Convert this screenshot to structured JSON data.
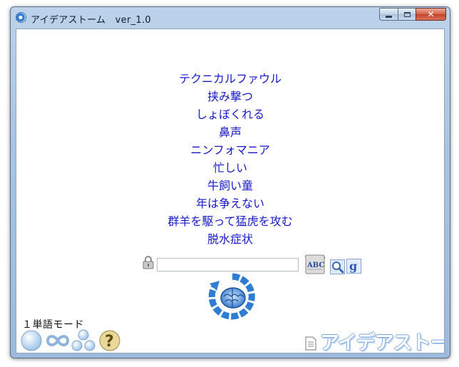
{
  "window": {
    "title": "アイデアストーム　ver_1.0",
    "minimize_label": "minimize",
    "maximize_label": "maximize",
    "close_glyph": "✕"
  },
  "words": [
    "テクニカルファウル",
    "挟み撃つ",
    "しょぼくれる",
    "鼻声",
    "ニンフォマニア",
    "忙しい",
    "牛飼い童",
    "年は争えない",
    "群羊を駆って猛虎を攻む",
    "脱水症状"
  ],
  "search": {
    "value": "",
    "placeholder": ""
  },
  "mode": {
    "label": "１単語モード"
  },
  "footer": {
    "brand": "アイデアストーム"
  },
  "colors": {
    "word_text": "#1619c8",
    "accent_blue": "#2f7dd3",
    "frame": "#a9c4e2"
  },
  "icons": {
    "app": "app-storm-icon",
    "lock": "lock-icon",
    "abc": "abc-scroll-icon",
    "search": "magnifier-icon",
    "google": "google-g-icon",
    "generate": "brain-refresh-icon",
    "modes": [
      "single-sphere-icon",
      "infinity-loop-icon",
      "three-bubbles-icon",
      "help-question-icon"
    ],
    "document": "document-icon"
  }
}
